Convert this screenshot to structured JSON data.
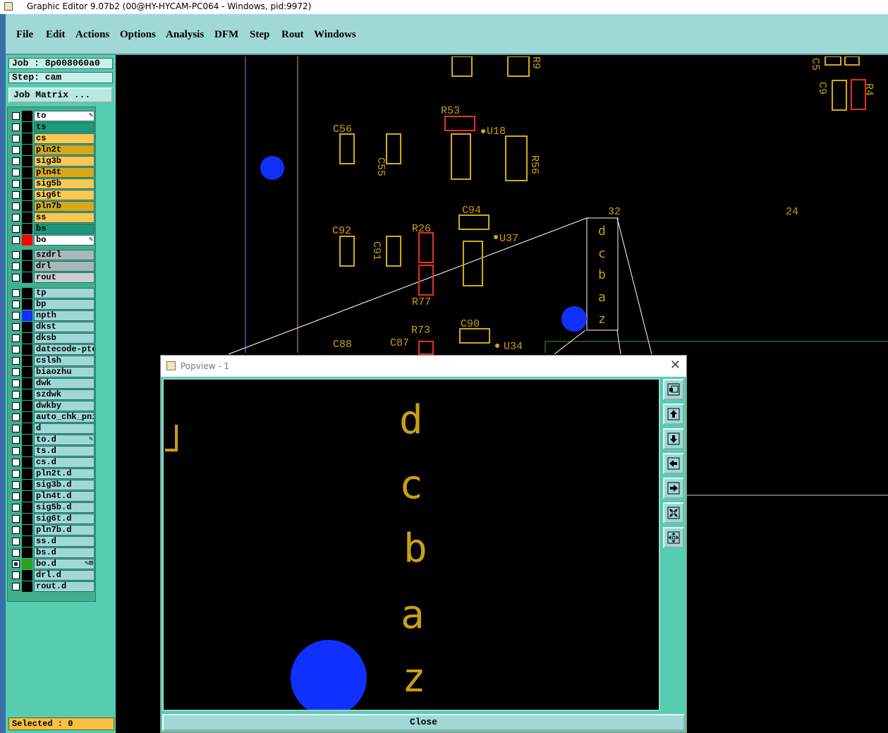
{
  "window": {
    "title": "Graphic Editor 9.07b2 (00@HY-HYCAM-PC064 - Windows, pid:9972)"
  },
  "menu": [
    "File",
    "Edit",
    "Actions",
    "Options",
    "Analysis",
    "DFM",
    "Step",
    "Rout",
    "Windows"
  ],
  "job": {
    "job_label": "Job : 8p008060a0",
    "step_label": "Step: cam",
    "matrix_button": "Job Matrix ..."
  },
  "layers": [
    {
      "name": "to",
      "color": "#ffffff",
      "swatch": "#000000",
      "checked": false,
      "mark": "✎"
    },
    {
      "name": "ts",
      "color": "#1a9a78",
      "swatch": "#000000",
      "checked": false,
      "mark": ""
    },
    {
      "name": "cs",
      "color": "#f8c850",
      "swatch": "#000000",
      "checked": false,
      "mark": ""
    },
    {
      "name": "pln2t",
      "color": "#d8a818",
      "swatch": "#000000",
      "checked": false,
      "mark": ""
    },
    {
      "name": "sig3b",
      "color": "#f8c850",
      "swatch": "#000000",
      "checked": false,
      "mark": ""
    },
    {
      "name": "pln4t",
      "color": "#d8a818",
      "swatch": "#000000",
      "checked": false,
      "mark": ""
    },
    {
      "name": "sig5b",
      "color": "#f8c850",
      "swatch": "#000000",
      "checked": false,
      "mark": ""
    },
    {
      "name": "sig6t",
      "color": "#f8c850",
      "swatch": "#000000",
      "checked": false,
      "mark": ""
    },
    {
      "name": "pln7b",
      "color": "#d8a818",
      "swatch": "#000000",
      "checked": false,
      "mark": ""
    },
    {
      "name": "ss",
      "color": "#f8c850",
      "swatch": "#000000",
      "checked": false,
      "mark": ""
    },
    {
      "name": "bs",
      "color": "#1a9a78",
      "swatch": "#000000",
      "checked": false,
      "mark": ""
    },
    {
      "name": "bo",
      "color": "#ffffff",
      "swatch": "#ff0000",
      "checked": false,
      "mark": "✎"
    },
    {
      "name": "szdrl",
      "color": "#a8b8b8",
      "swatch": "#000000",
      "checked": false,
      "mark": ""
    },
    {
      "name": "drl",
      "color": "#a8b8b8",
      "swatch": "#000000",
      "checked": false,
      "mark": ""
    },
    {
      "name": "rout",
      "color": "#c8d0d0",
      "swatch": "#000000",
      "checked": false,
      "mark": ""
    },
    {
      "name": "tp",
      "color": "#a0d8d8",
      "swatch": "#000000",
      "checked": false,
      "mark": ""
    },
    {
      "name": "bp",
      "color": "#a0d8d8",
      "swatch": "#000000",
      "checked": false,
      "mark": ""
    },
    {
      "name": "npth",
      "color": "#a0d8d8",
      "swatch": "#1030ff",
      "checked": false,
      "mark": ""
    },
    {
      "name": "dkst",
      "color": "#a0d8d8",
      "swatch": "#000000",
      "checked": false,
      "mark": ""
    },
    {
      "name": "dksb",
      "color": "#a0d8d8",
      "swatch": "#000000",
      "checked": false,
      "mark": ""
    },
    {
      "name": "datecode-pte",
      "color": "#a0d8d8",
      "swatch": "#000000",
      "checked": false,
      "mark": ""
    },
    {
      "name": "cslsh",
      "color": "#a0d8d8",
      "swatch": "#000000",
      "checked": false,
      "mark": ""
    },
    {
      "name": "biaozhu",
      "color": "#a0d8d8",
      "swatch": "#000000",
      "checked": false,
      "mark": ""
    },
    {
      "name": "dwk",
      "color": "#a0d8d8",
      "swatch": "#000000",
      "checked": false,
      "mark": ""
    },
    {
      "name": "szdwk",
      "color": "#a0d8d8",
      "swatch": "#000000",
      "checked": false,
      "mark": ""
    },
    {
      "name": "dwkby",
      "color": "#a0d8d8",
      "swatch": "#000000",
      "checked": false,
      "mark": ""
    },
    {
      "name": "auto_chk_pni",
      "color": "#a0d8d8",
      "swatch": "#000000",
      "checked": false,
      "mark": ""
    },
    {
      "name": "d",
      "color": "#a0d8d8",
      "swatch": "#000000",
      "checked": false,
      "mark": ""
    },
    {
      "name": "to.d",
      "color": "#a0d8d8",
      "swatch": "#000000",
      "checked": false,
      "mark": "✎"
    },
    {
      "name": "ts.d",
      "color": "#a0d8d8",
      "swatch": "#000000",
      "checked": false,
      "mark": ""
    },
    {
      "name": "cs.d",
      "color": "#a0d8d8",
      "swatch": "#000000",
      "checked": false,
      "mark": ""
    },
    {
      "name": "pln2t.d",
      "color": "#a0d8d8",
      "swatch": "#000000",
      "checked": false,
      "mark": ""
    },
    {
      "name": "sig3b.d",
      "color": "#a0d8d8",
      "swatch": "#000000",
      "checked": false,
      "mark": ""
    },
    {
      "name": "pln4t.d",
      "color": "#a0d8d8",
      "swatch": "#000000",
      "checked": false,
      "mark": ""
    },
    {
      "name": "sig5b.d",
      "color": "#a0d8d8",
      "swatch": "#000000",
      "checked": false,
      "mark": ""
    },
    {
      "name": "sig6t.d",
      "color": "#a0d8d8",
      "swatch": "#000000",
      "checked": false,
      "mark": ""
    },
    {
      "name": "pln7b.d",
      "color": "#a0d8d8",
      "swatch": "#000000",
      "checked": false,
      "mark": ""
    },
    {
      "name": "ss.d",
      "color": "#a0d8d8",
      "swatch": "#000000",
      "checked": false,
      "mark": ""
    },
    {
      "name": "bs.d",
      "color": "#a0d8d8",
      "swatch": "#000000",
      "checked": false,
      "mark": ""
    },
    {
      "name": "bo.d",
      "color": "#a0d8d8",
      "swatch": "#30a020",
      "checked": true,
      "mark": "✎⊞"
    },
    {
      "name": "drl.d",
      "color": "#a0d8d8",
      "swatch": "#000000",
      "checked": false,
      "mark": ""
    },
    {
      "name": "rout.d",
      "color": "#a0d8d8",
      "swatch": "#000000",
      "checked": false,
      "mark": ""
    }
  ],
  "status": {
    "selected": "Selected : 0"
  },
  "canvas_labels": {
    "r53": "R53",
    "u18": "U18",
    "c56": "C56",
    "c55": "C55",
    "r56": "R56",
    "c94": "C94",
    "c92": "C92",
    "r26": "R26",
    "c91": "C91",
    "u37": "U37",
    "r77": "R77",
    "c90": "C90",
    "r73": "R73",
    "c88": "C88",
    "c87": "C87",
    "u34": "U34",
    "n32": "32",
    "n24": "24",
    "c9": "C9",
    "r4": "R4",
    "r9": "R9",
    "c5": "C5",
    "zoom_letters": [
      "d",
      "c",
      "b",
      "a",
      "z"
    ]
  },
  "popview": {
    "title": "Popview - 1",
    "close_x": "✕",
    "letters": [
      "d",
      "c",
      "b",
      "a",
      "z"
    ],
    "close_label": "Close"
  },
  "colors": {
    "pad_outline": "#d8a818",
    "pad_red": "#e83020",
    "npth_blue": "#1030ff",
    "silk_text": "#c8a010"
  }
}
